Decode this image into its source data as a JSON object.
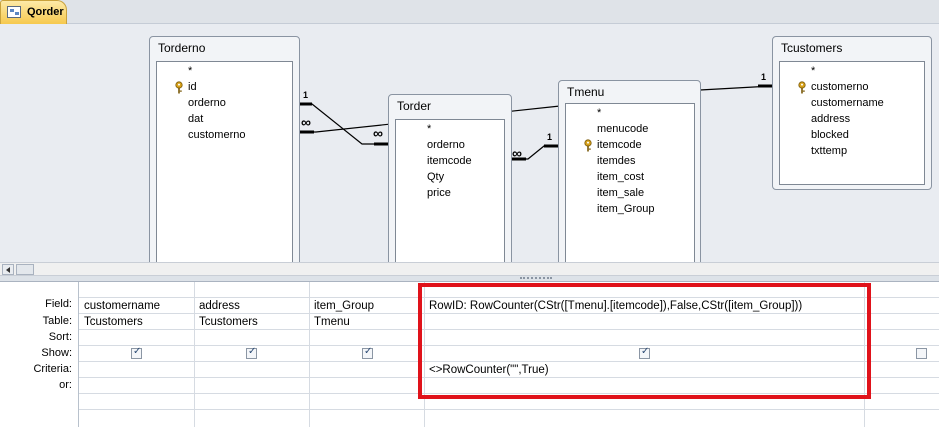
{
  "window": {
    "tab_title": "Qorder"
  },
  "relationship_pane": {
    "tables": [
      {
        "title": "Torderno",
        "fields": [
          {
            "name": "*",
            "key": false
          },
          {
            "name": "id",
            "key": true
          },
          {
            "name": "orderno",
            "key": false
          },
          {
            "name": "dat",
            "key": false
          },
          {
            "name": "customerno",
            "key": false
          }
        ]
      },
      {
        "title": "Torder",
        "fields": [
          {
            "name": "*",
            "key": false
          },
          {
            "name": "orderno",
            "key": false
          },
          {
            "name": "itemcode",
            "key": false
          },
          {
            "name": "Qty",
            "key": false
          },
          {
            "name": "price",
            "key": false
          }
        ]
      },
      {
        "title": "Tmenu",
        "fields": [
          {
            "name": "*",
            "key": false
          },
          {
            "name": "menucode",
            "key": false
          },
          {
            "name": "itemcode",
            "key": true
          },
          {
            "name": "itemdes",
            "key": false
          },
          {
            "name": "item_cost",
            "key": false
          },
          {
            "name": "item_sale",
            "key": false
          },
          {
            "name": "item_Group",
            "key": false
          }
        ]
      },
      {
        "title": "Tcustomers",
        "fields": [
          {
            "name": "*",
            "key": false
          },
          {
            "name": "customerno",
            "key": true
          },
          {
            "name": "customername",
            "key": false
          },
          {
            "name": "address",
            "key": false
          },
          {
            "name": "blocked",
            "key": false
          },
          {
            "name": "txttemp",
            "key": false
          }
        ]
      }
    ],
    "relationship_labels": {
      "one": "1",
      "many": "∞"
    }
  },
  "design_grid": {
    "row_labels": [
      "Field:",
      "Table:",
      "Sort:",
      "Show:",
      "Criteria:",
      "or:"
    ],
    "columns": [
      {
        "field": "customername",
        "table": "Tcustomers",
        "sort": "",
        "show": true,
        "criteria": "",
        "or": ""
      },
      {
        "field": "address",
        "table": "Tcustomers",
        "sort": "",
        "show": true,
        "criteria": "",
        "or": ""
      },
      {
        "field": "item_Group",
        "table": "Tmenu",
        "sort": "",
        "show": true,
        "criteria": "",
        "or": ""
      },
      {
        "field": "RowID: RowCounter(CStr([Tmenu].[itemcode]),False,CStr([item_Group]))",
        "table": "",
        "sort": "",
        "show": true,
        "criteria": "<>RowCounter(\"\",True)",
        "or": ""
      },
      {
        "field": "",
        "table": "",
        "sort": "",
        "show": false,
        "criteria": "",
        "or": ""
      }
    ]
  },
  "colors": {
    "highlight_border": "#e0121a",
    "tab_gold": "#f6c94e"
  }
}
